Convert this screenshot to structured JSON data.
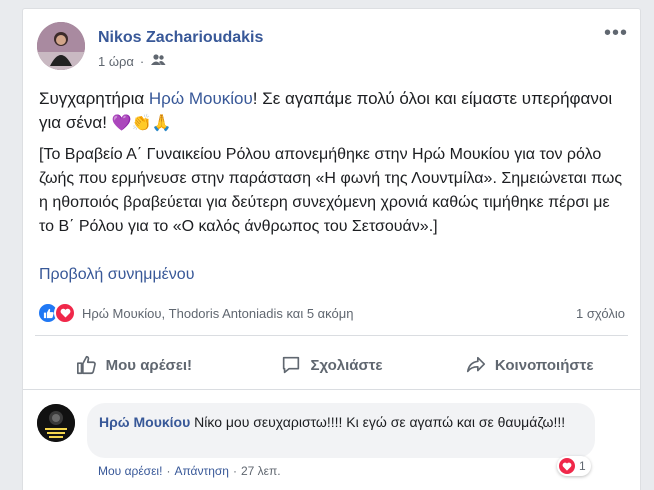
{
  "post": {
    "author": "Nikos Zacharioudakis",
    "time": "1 ώρα",
    "dot": "·",
    "more": "•••",
    "text_before": "Συγχαρητήρια ",
    "mention": "Ηρώ Μουκίου",
    "text_after": "! Σε αγαπάμε πολύ όλοι και είμαστε υπερήφανοι για σένα! ",
    "emojis": [
      "💜",
      "👏",
      "🙏"
    ],
    "paragraph": "[Το Βραβείο Α΄ Γυναικείου Ρόλου απονεμήθηκε στην Ηρώ Μουκίου για τον ρόλο ζωής που ερμήνευσε στην παράσταση «Η φωνή της Λουντμίλα». Σημειώνεται πως η ηθοποιός βραβεύεται για δεύτερη συνεχόμενη χρονιά καθώς τιμήθηκε πέρσι με το Β΄ Ρόλου για το «Ο καλός άνθρωπος του Σετσουάν».]",
    "attachment_link": "Προβολή συνημμένου"
  },
  "reactions": {
    "names": "Ηρώ Μουκίου, Thodoris Antoniadis και 5 ακόμη",
    "comment_count": "1 σχόλιο",
    "colors": {
      "like": "#2078f4",
      "love": "#f0284a"
    }
  },
  "actions": {
    "like": "Μου αρέσει!",
    "comment": "Σχολιάστε",
    "share": "Κοινοποιήστε"
  },
  "comment": {
    "author": "Ηρώ Μουκίου",
    "text": " Νίκο μου σευχαριστω!!!! Κι εγώ σε αγαπώ και σε θαυμάζω!!!",
    "avatar_text": "SUPPORT ART WORKERS",
    "like": "Μου αρέσει!",
    "reply": "Απάντηση",
    "time": "27 λεπ.",
    "dot": "·",
    "reaction_count": "1"
  }
}
